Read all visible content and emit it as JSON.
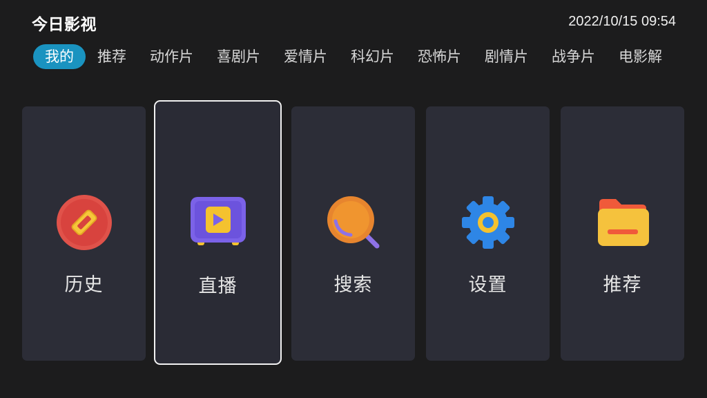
{
  "header": {
    "title": "今日影视",
    "clock": "2022/10/15 09:54"
  },
  "tabs": [
    {
      "label": "我的",
      "active": true
    },
    {
      "label": "推荐"
    },
    {
      "label": "动作片"
    },
    {
      "label": "喜剧片"
    },
    {
      "label": "爱情片"
    },
    {
      "label": "科幻片"
    },
    {
      "label": "恐怖片"
    },
    {
      "label": "剧情片"
    },
    {
      "label": "战争片"
    },
    {
      "label": "电影解"
    }
  ],
  "cards": [
    {
      "label": "历史",
      "icon": "compass-icon",
      "focused": false
    },
    {
      "label": "直播",
      "icon": "tv-play-icon",
      "focused": true
    },
    {
      "label": "搜索",
      "icon": "search-icon",
      "focused": false
    },
    {
      "label": "设置",
      "icon": "gear-icon",
      "focused": false
    },
    {
      "label": "推荐",
      "icon": "folder-icon",
      "focused": false
    }
  ],
  "colors": {
    "background": "#1c1c1d",
    "card": "#2c2d37",
    "active_tab": "#1a93c0",
    "focus_border": "#f2f2f2"
  }
}
